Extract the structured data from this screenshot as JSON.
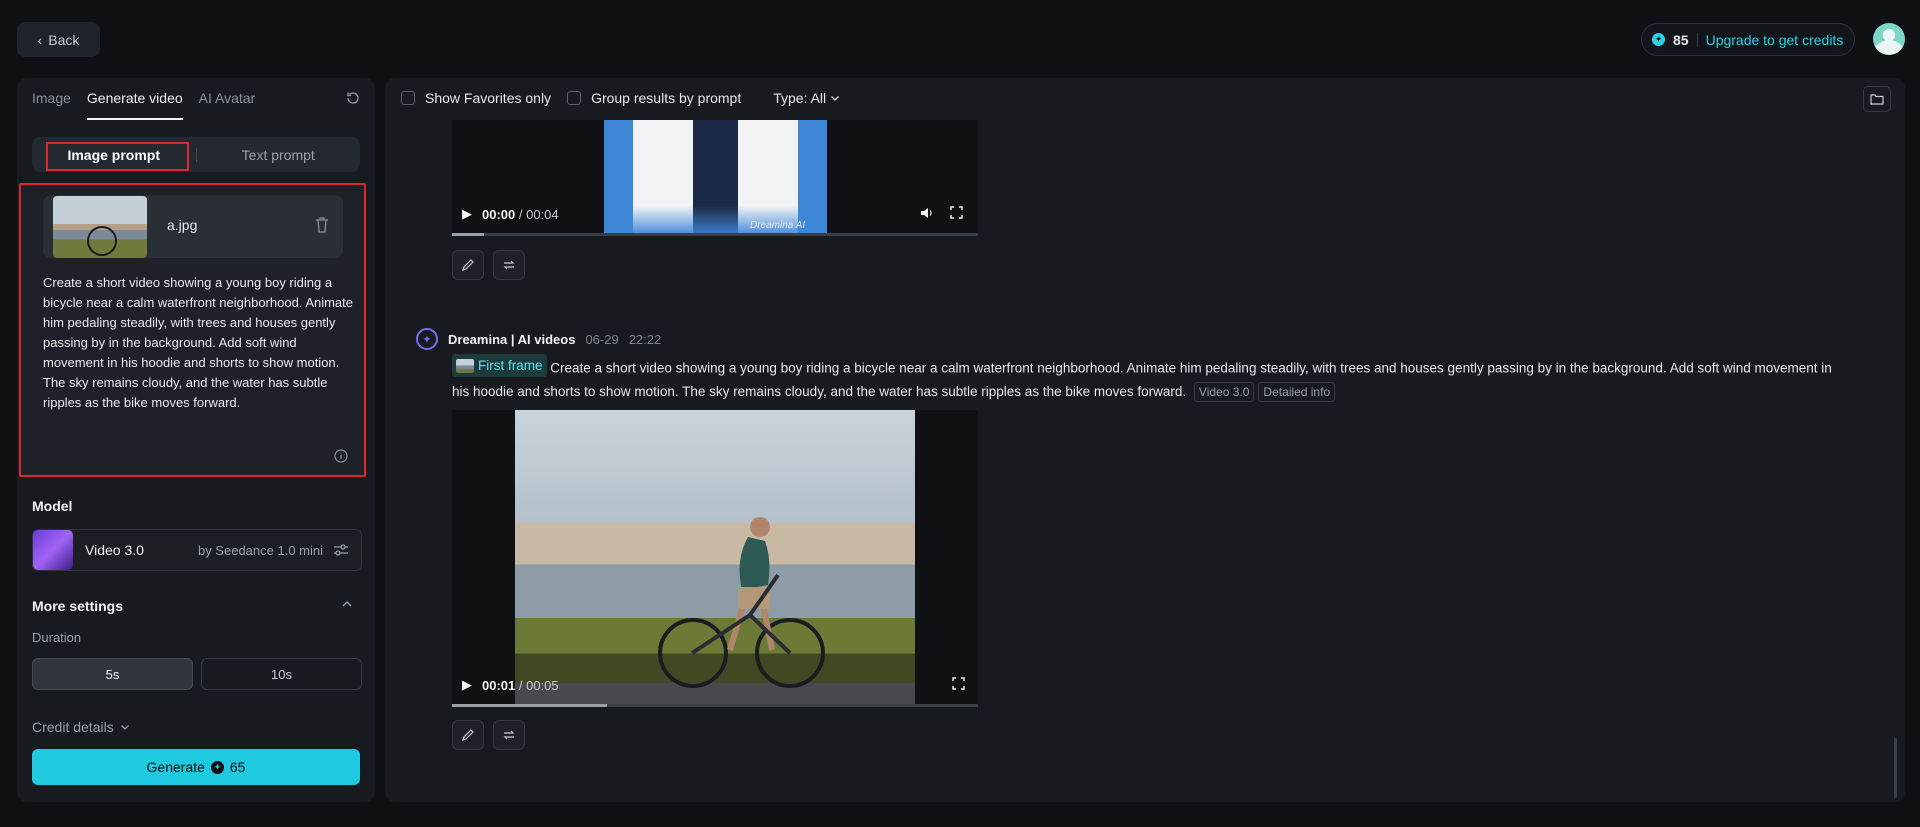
{
  "header": {
    "back_label": "Back",
    "credits_count": "85",
    "upgrade_label": "Upgrade to get credits"
  },
  "left": {
    "tabs": [
      {
        "label": "Image"
      },
      {
        "label": "Generate video"
      },
      {
        "label": "AI Avatar"
      }
    ],
    "prompt_modes": {
      "image": "Image prompt",
      "text": "Text prompt"
    },
    "file_name": "a.jpg",
    "prompt_text": "Create a short video showing a young boy riding a bicycle near a calm waterfront neighborhood. Animate him pedaling steadily, with trees and houses gently passing by in the background. Add soft wind movement in his hoodie and shorts to show motion. The sky remains cloudy, and the water has subtle ripples as the bike moves forward.",
    "model_label": "Model",
    "model_name": "Video 3.0",
    "model_by": "by Seedance 1.0 mini",
    "more_settings": "More settings",
    "duration_label": "Duration",
    "duration_options": [
      "5s",
      "10s"
    ],
    "credit_details": "Credit details",
    "generate_label": "Generate",
    "generate_cost": "65"
  },
  "right": {
    "filters": {
      "favorites": "Show Favorites only",
      "group": "Group results by prompt",
      "type": "Type: All"
    },
    "video1": {
      "time_current": "00:00",
      "time_total": "/ 00:04",
      "watermark": "Dreamina AI"
    },
    "entry": {
      "brand": "Dreamina | AI videos",
      "date": "06-29",
      "time": "22:22",
      "first_frame": "First frame",
      "prompt": "Create a short video showing a young boy riding a bicycle near a calm waterfront neighborhood. Animate him pedaling steadily, with trees and houses gently passing by in the background. Add soft wind movement in his hoodie and shorts to show motion. The sky remains cloudy, and the water has subtle ripples as the bike moves forward.",
      "tag_model": "Video 3.0",
      "tag_info": "Detailed info"
    },
    "video2": {
      "time_current": "00:01",
      "time_total": "/ 00:05"
    }
  }
}
